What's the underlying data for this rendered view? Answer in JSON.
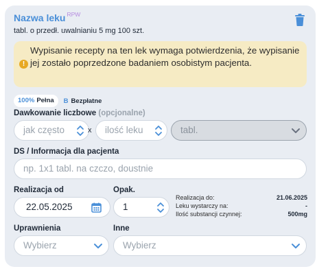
{
  "drug": {
    "name": "Nazwa leku",
    "badge": "RPW",
    "description": "tabl. o przedł. uwalnianiu 5 mg 100 szt."
  },
  "warning": {
    "text": "Wypisanie recepty na ten lek wymaga potwierdzenia, że wypisanie jej zostało poprzedzone badaniem osobistym pacjenta."
  },
  "refund": {
    "percent": "100%",
    "percent_label": "Pełna",
    "code": "B",
    "code_label": "Bezpłatne"
  },
  "dosage": {
    "label": "Dawkowanie liczbowe",
    "optional": "(opcjonalne)",
    "how_often_placeholder": "jak często",
    "times": "x",
    "amount_placeholder": "ilość leku",
    "unit_value": "tabl."
  },
  "ds": {
    "label": "DS / Informacja dla pacjenta",
    "placeholder": "np. 1x1 tabl. na czczo, doustnie"
  },
  "realization": {
    "label": "Realizacja od",
    "value": "22.05.2025"
  },
  "package": {
    "label": "Opak.",
    "value": "1"
  },
  "summary": {
    "rows": [
      {
        "key": "Realizacja do:",
        "value": "21.06.2025"
      },
      {
        "key": "Leku wystarczy na:",
        "value": "-"
      },
      {
        "key": "Ilość substancji czynnej:",
        "value": "500mg"
      }
    ]
  },
  "permissions": {
    "label": "Uprawnienia",
    "placeholder": "Wybierz"
  },
  "other": {
    "label": "Inne",
    "placeholder": "Wybierz"
  },
  "colors": {
    "accent": "#4a8fd8",
    "badge": "#b58ae0",
    "warning_bg": "#f6ebc4",
    "warning_icon": "#e7a922",
    "card_bg": "#e9edf3"
  }
}
